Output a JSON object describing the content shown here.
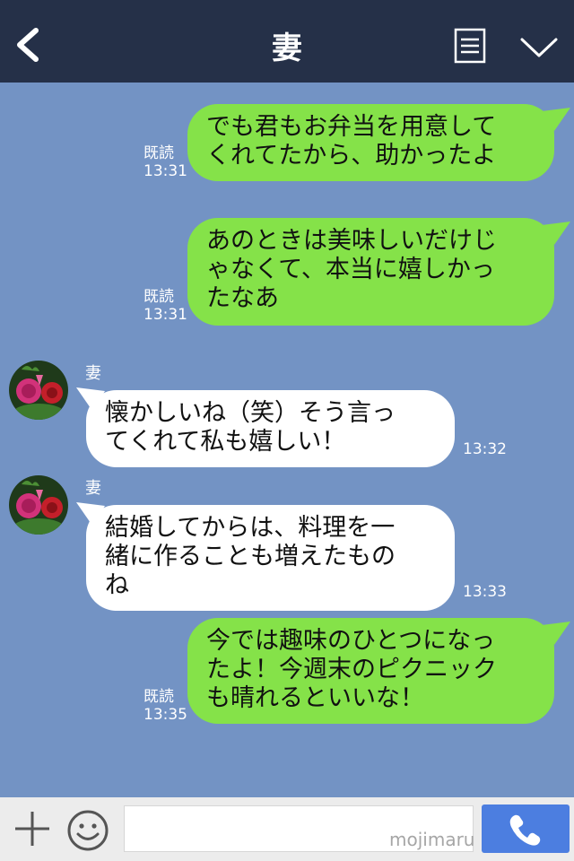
{
  "header": {
    "title": "妻"
  },
  "messages": [
    {
      "lines": [
        "でも君もお弁当を用意して",
        "くれてたから、助かったよ"
      ],
      "read": "既読",
      "time": "13:31"
    },
    {
      "lines": [
        "あのときは美味しいだけじ",
        "ゃなくて、本当に嬉しかっ",
        "たなあ"
      ],
      "read": "既読",
      "time": "13:31"
    },
    {
      "sender": "妻",
      "lines": [
        "懐かしいね（笑）そう言っ",
        "てくれて私も嬉しい！"
      ],
      "time": "13:32"
    },
    {
      "sender": "妻",
      "lines": [
        "結婚してからは、料理を一",
        "緒に作ることも増えたもの",
        "ね"
      ],
      "time": "13:33"
    },
    {
      "lines": [
        "今では趣味のひとつになっ",
        "たよ！今週末のピクニック",
        "も晴れるといいな！"
      ],
      "read": "既読",
      "time": "13:35"
    }
  ],
  "footer": {
    "input_placeholder": "",
    "watermark": "mojimaru"
  },
  "colors": {
    "header_bg": "#253048",
    "chat_bg": "#7393c4",
    "sent_bubble": "#85e249",
    "received_bubble": "#ffffff",
    "call_button": "#4c7ee0"
  },
  "icons": [
    "back-icon",
    "menu-icon",
    "chevron-down-icon",
    "plus-icon",
    "smile-icon",
    "phone-icon"
  ]
}
